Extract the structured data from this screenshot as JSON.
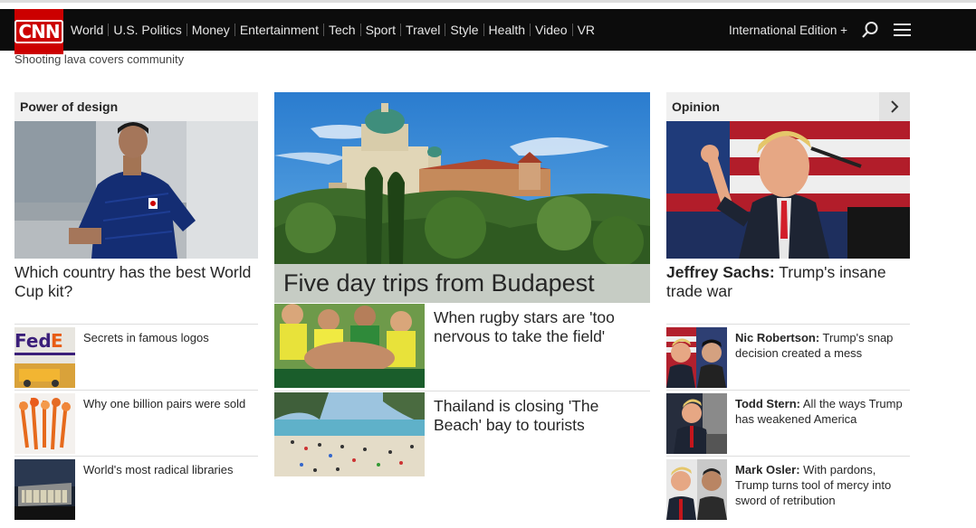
{
  "nav": {
    "logo": "CNN",
    "links": [
      "World",
      "U.S. Politics",
      "Money",
      "Entertainment",
      "Tech",
      "Sport",
      "Travel",
      "Style",
      "Health",
      "Video",
      "VR"
    ],
    "edition": "International Edition +"
  },
  "breaking": "Shooting lava covers community",
  "left": {
    "section": "Power of design",
    "hero_headline": "Which country has the best World Cup kit?",
    "items": [
      {
        "text": "Secrets in famous logos"
      },
      {
        "text": "Why one billion pairs were sold"
      },
      {
        "text": "World's most radical libraries"
      }
    ]
  },
  "middle": {
    "hero_headline": "Five day trips from Budapest",
    "items": [
      {
        "text": "When rugby stars are 'too nervous to take the field'"
      },
      {
        "text": "Thailand is closing 'The Beach' bay to tourists"
      }
    ]
  },
  "right": {
    "section": "Opinion",
    "hero_author": "Jeffrey Sachs:",
    "hero_text": " Trump's insane trade war",
    "items": [
      {
        "author": "Nic Robertson:",
        "text": " Trump's snap decision created a mess"
      },
      {
        "author": "Todd Stern:",
        "text": " All the ways Trump has weakened America"
      },
      {
        "author": "Mark Osler:",
        "text": " With pardons, Trump turns tool of mercy into sword of retribution"
      }
    ]
  },
  "colors": {
    "brand": "#cc0000",
    "nav_bg": "#0c0c0c",
    "section_bg": "#f0f0f0"
  }
}
